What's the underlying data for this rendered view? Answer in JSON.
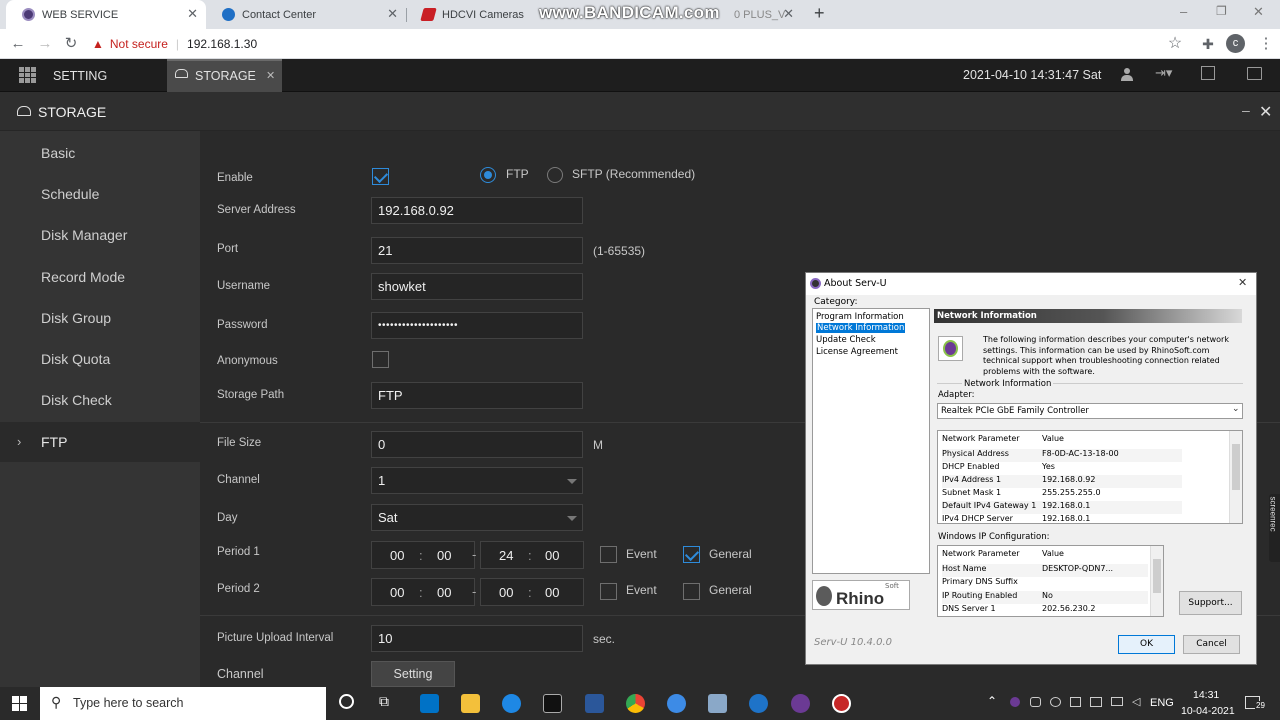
{
  "browser": {
    "tabs": [
      {
        "title": "WEB SERVICE",
        "active": true
      },
      {
        "title": "Contact Center",
        "active": false
      },
      {
        "title": "HDCVI Cameras",
        "active": false
      },
      {
        "title": "0 PLUS_V",
        "active": false
      }
    ],
    "watermark": "www.BANDICAM.com",
    "security_label": "Not secure",
    "url": "192.168.1.30",
    "profile_letter": "c"
  },
  "app_header": {
    "setting_label": "SETTING",
    "tab_label": "STORAGE",
    "datetime": "2021-04-10 14:31:47 Sat"
  },
  "page_title": "STORAGE",
  "sidebar": {
    "items": [
      {
        "label": "Basic"
      },
      {
        "label": "Schedule"
      },
      {
        "label": "Disk Manager"
      },
      {
        "label": "Record Mode"
      },
      {
        "label": "Disk Group"
      },
      {
        "label": "Disk Quota"
      },
      {
        "label": "Disk Check"
      },
      {
        "label": "FTP",
        "selected": true
      }
    ]
  },
  "form": {
    "enable_label": "Enable",
    "enable_checked": true,
    "ftp_label": "FTP",
    "sftp_label": "SFTP (Recommended)",
    "protocol": "FTP",
    "server_label": "Server Address",
    "server_value": "192.168.0.92",
    "port_label": "Port",
    "port_value": "21",
    "port_range": "(1-65535)",
    "username_label": "Username",
    "username_value": "showket",
    "password_label": "Password",
    "password_value": "••••••••••••••••••••",
    "anonymous_label": "Anonymous",
    "anonymous_checked": false,
    "storage_path_label": "Storage Path",
    "storage_path_value": "FTP",
    "file_size_label": "File Size",
    "file_size_value": "0",
    "file_size_unit": "M",
    "channel_label": "Channel",
    "channel_value": "1",
    "day_label": "Day",
    "day_value": "Sat",
    "period1_label": "Period 1",
    "period1": {
      "sh": "00",
      "sm": "00",
      "eh": "24",
      "em": "00",
      "event": false,
      "general": true
    },
    "period2_label": "Period 2",
    "period2": {
      "sh": "00",
      "sm": "00",
      "eh": "00",
      "em": "00",
      "event": false,
      "general": false
    },
    "event_label": "Event",
    "general_label": "General",
    "time_colon": ":",
    "time_dash": "-",
    "upload_interval_label": "Picture Upload Interval",
    "upload_interval_value": "10",
    "upload_interval_unit": "sec.",
    "channel2_label": "Channel",
    "setting_button": "Setting"
  },
  "dialog": {
    "title": "About Serv-U",
    "category_label": "Category:",
    "categories": [
      "Program Information",
      "Network Information",
      "Update Check",
      "License Agreement"
    ],
    "selected_category": "Network Information",
    "section_header": "Network Information",
    "description": "The following information describes your computer's network settings.  This information can be used by RhinoSoft.com technical support when troubleshooting connection related problems with the software.",
    "group_label": "Network Information",
    "adapter_label": "Adapter:",
    "adapter_value": "Realtek PCIe GbE Family Controller",
    "grid1_headers": [
      "Network Parameter",
      "Value"
    ],
    "grid1_rows": [
      [
        "Physical Address",
        "F8-0D-AC-13-18-00"
      ],
      [
        "DHCP Enabled",
        "Yes"
      ],
      [
        "IPv4 Address 1",
        "192.168.0.92"
      ],
      [
        "Subnet Mask 1",
        "255.255.255.0"
      ],
      [
        "Default IPv4 Gateway 1",
        "192.168.0.1"
      ],
      [
        "IPv4 DHCP Server",
        "192.168.0.1"
      ]
    ],
    "windows_ip_label": "Windows IP Configuration:",
    "grid2_headers": [
      "Network Parameter",
      "Value"
    ],
    "grid2_rows": [
      [
        "Host Name",
        "DESKTOP-QDN7..."
      ],
      [
        "Primary DNS Suffix",
        ""
      ],
      [
        "IP Routing Enabled",
        "No"
      ],
      [
        "DNS Server 1",
        "202.56.230.2"
      ]
    ],
    "logo_text": "Rhino",
    "logo_small": "Soft",
    "version": "Serv-U 10.4.0.0",
    "support_button": "Support...",
    "ok_button": "OK",
    "cancel_button": "Cancel"
  },
  "side_watermark": "screenrec",
  "taskbar": {
    "search_placeholder": "Type here to search",
    "language": "ENG",
    "time": "14:31",
    "date": "10-04-2021",
    "notification_count": "29"
  },
  "colors": {
    "accent": "#2e8bda",
    "background": "#2a2a2a",
    "sidebar": "#343434"
  }
}
